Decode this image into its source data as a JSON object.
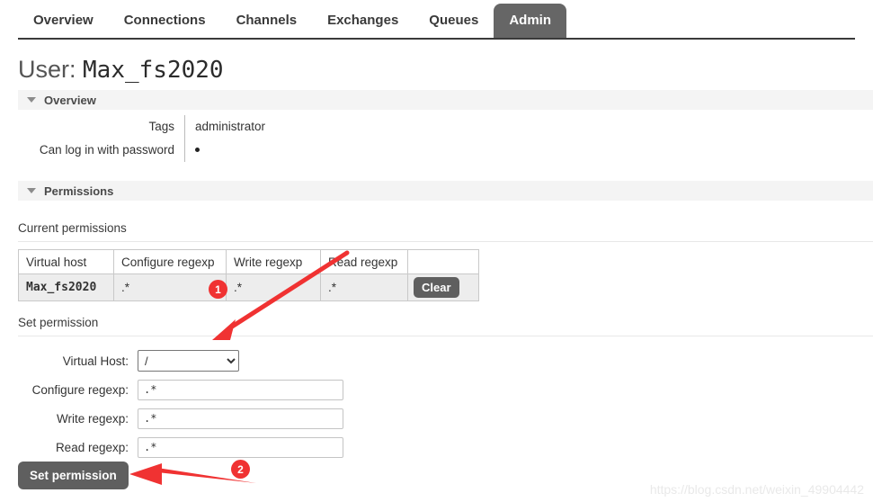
{
  "nav": {
    "items": [
      {
        "label": "Overview",
        "active": false
      },
      {
        "label": "Connections",
        "active": false
      },
      {
        "label": "Channels",
        "active": false
      },
      {
        "label": "Exchanges",
        "active": false
      },
      {
        "label": "Queues",
        "active": false
      },
      {
        "label": "Admin",
        "active": true
      }
    ]
  },
  "page": {
    "title_label": "User:",
    "title_value": "Max_fs2020"
  },
  "overview": {
    "header": "Overview",
    "rows": [
      {
        "key": "Tags",
        "value": "administrator"
      },
      {
        "key": "Can log in with password",
        "value": ""
      }
    ]
  },
  "permissions": {
    "header": "Permissions",
    "current_caption": "Current permissions",
    "table": {
      "columns": [
        "Virtual host",
        "Configure regexp",
        "Write regexp",
        "Read regexp",
        ""
      ],
      "rows": [
        {
          "vhost": "Max_fs2020",
          "configure": ".*",
          "write": ".*",
          "read": ".*",
          "action_label": "Clear"
        }
      ]
    },
    "set_caption": "Set permission",
    "form": {
      "vhost_label": "Virtual Host:",
      "vhost_value": "/",
      "vhost_options": [
        "/"
      ],
      "configure_label": "Configure regexp:",
      "configure_value": ".*",
      "write_label": "Write regexp:",
      "write_value": ".*",
      "read_label": "Read regexp:",
      "read_value": ".*",
      "submit_label": "Set permission"
    }
  },
  "annotations": {
    "marker_one": "1",
    "marker_two": "2",
    "color": "#f03232"
  },
  "watermark": "https://blog.csdn.net/weixin_49904442"
}
